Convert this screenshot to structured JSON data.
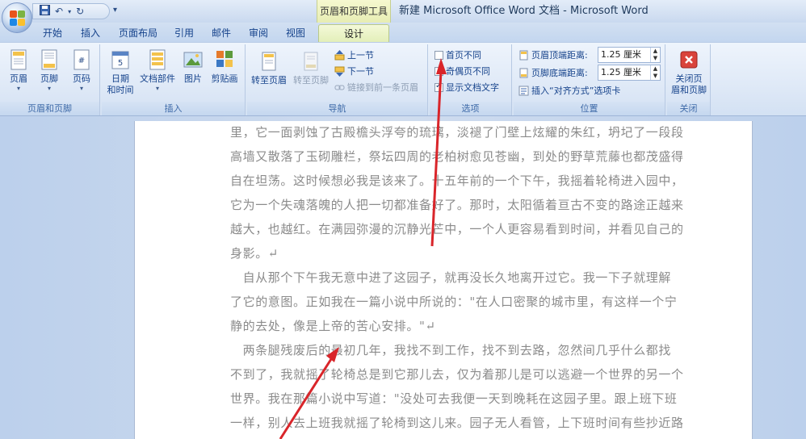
{
  "window": {
    "title": "新建 Microsoft Office Word 文档 - Microsoft Word",
    "context_title": "页眉和页脚工具",
    "qat": {
      "save_icon": "save-icon",
      "undo_icon": "undo-icon",
      "redo_icon": "redo-icon",
      "more": "▾"
    }
  },
  "tabs": [
    "开始",
    "插入",
    "页面布局",
    "引用",
    "邮件",
    "审阅",
    "视图",
    "设计"
  ],
  "active_tab": "设计",
  "ribbon": {
    "group_header_footer": {
      "label": "页眉和页脚",
      "header": "页眉",
      "footer": "页脚",
      "page_number": "页码"
    },
    "group_insert": {
      "label": "插入",
      "date_line1": "日期",
      "date_line2": "和时间",
      "doc_parts": "文档部件",
      "picture": "图片",
      "clipart": "剪贴画"
    },
    "group_nav": {
      "label": "导航",
      "goto_header": "转至页眉",
      "goto_footer": "转至页脚",
      "prev": "上一节",
      "next": "下一节",
      "link_prev": "链接到前一条页眉"
    },
    "group_options": {
      "label": "选项",
      "first_page": "首页不同",
      "odd_even": "奇偶页不同",
      "show_text": "显示文档文字",
      "first_page_checked": false,
      "odd_even_checked": false,
      "show_text_checked": true
    },
    "group_position": {
      "label": "位置",
      "header_top": "页眉顶端距离:",
      "header_top_value": "1.25 厘米",
      "footer_bottom": "页脚底端距离:",
      "footer_bottom_value": "1.25 厘米",
      "insert_tab": "插入“对齐方式”选项卡"
    },
    "group_close": {
      "label": "关闭",
      "close_line1": "关闭页",
      "close_line2": "眉和页脚"
    }
  },
  "document": {
    "lines": [
      "里，它一面剥蚀了古殿檐头浮夸的琉璃，淡褪了门壁上炫耀的朱红，坍圮了一段段",
      "高墙又散落了玉砌雕栏，祭坛四周的老柏树愈见苍幽，到处的野草荒藤也都茂盛得",
      "自在坦荡。这时候想必我是该来了。十五年前的一个下午，我摇着轮椅进入园中，",
      "它为一个失魂落魄的人把一切都准备好了。那时，太阳循着亘古不变的路途正越来",
      "越大，也越红。在满园弥漫的沉静光芒中，一个人更容易看到时间，并看见自己的",
      "身影。↵",
      "　自从那个下午我无意中进了这园子，就再没长久地离开过它。我一下子就理解",
      "了它的意图。正如我在一篇小说中所说的：\"在人口密聚的城市里，有这样一个宁",
      "静的去处，像是上帝的苦心安排。\"↵",
      "　两条腿残废后的最初几年，我找不到工作，找不到去路，忽然间几乎什么都找",
      "不到了，我就摇了轮椅总是到它那儿去，仅为着那儿是可以逃避一个世界的另一个",
      "世界。我在那篇小说中写道：\"没处可去我便一天到晚耗在这园子里。跟上班下班",
      "一样，别人去上班我就摇了轮椅到这儿来。园子无人看管，上下班时间有些抄近路"
    ]
  },
  "colors": {
    "arrow": "#d9252a",
    "accent": "#15428b"
  }
}
